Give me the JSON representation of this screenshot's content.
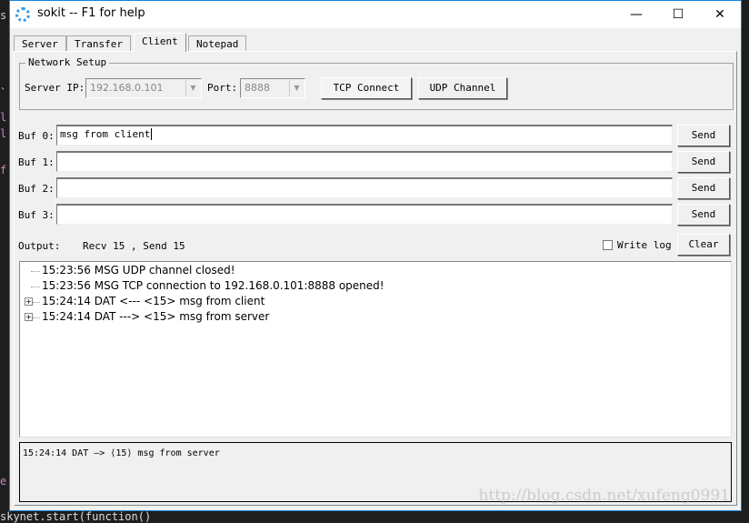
{
  "background": {
    "left_glyphs": [
      "s",
      "`",
      "l",
      "l",
      "f",
      "e"
    ],
    "bottom_code": "skynet.start(function()"
  },
  "window": {
    "title": "sokit -- F1 for help",
    "icon": "sokit-logo-icon",
    "controls": {
      "minimize": "—",
      "maximize": "☐",
      "close": "✕"
    }
  },
  "tabs": [
    {
      "label": "Server"
    },
    {
      "label": "Transfer"
    },
    {
      "label": "Client",
      "active": true
    },
    {
      "label": "Notepad"
    }
  ],
  "network": {
    "group_label": "Network Setup",
    "server_ip_label": "Server IP:",
    "server_ip": "192.168.0.101",
    "port_label": "Port:",
    "port": "8888",
    "tcp_button": "TCP Connect",
    "udp_button": "UDP Channel"
  },
  "buffers": [
    {
      "label": "Buf 0:",
      "value": "msg from client",
      "send": "Send"
    },
    {
      "label": "Buf 1:",
      "value": "",
      "send": "Send"
    },
    {
      "label": "Buf 2:",
      "value": "",
      "send": "Send"
    },
    {
      "label": "Buf 3:",
      "value": "",
      "send": "Send"
    }
  ],
  "output": {
    "label": "Output:",
    "stats": "Recv 15 , Send 15",
    "write_log": "Write log",
    "write_log_checked": false,
    "clear": "Clear"
  },
  "log": [
    {
      "text": "15:23:56 MSG UDP channel closed!",
      "expandable": false
    },
    {
      "text": "15:23:56 MSG TCP connection to 192.168.0.101:8888 opened!",
      "expandable": false
    },
    {
      "text": "15:24:14 DAT <--- <15> msg from client",
      "expandable": true
    },
    {
      "text": "15:24:14 DAT ---> <15> msg from server",
      "expandable": true
    }
  ],
  "detail": "15:24:14 DAT —> ⟨15⟩ msg from server",
  "watermark": "http://blog.csdn.net/xufeng0991",
  "colors": {
    "window_border": "#1883d7",
    "panel": "#f0f0f0"
  }
}
